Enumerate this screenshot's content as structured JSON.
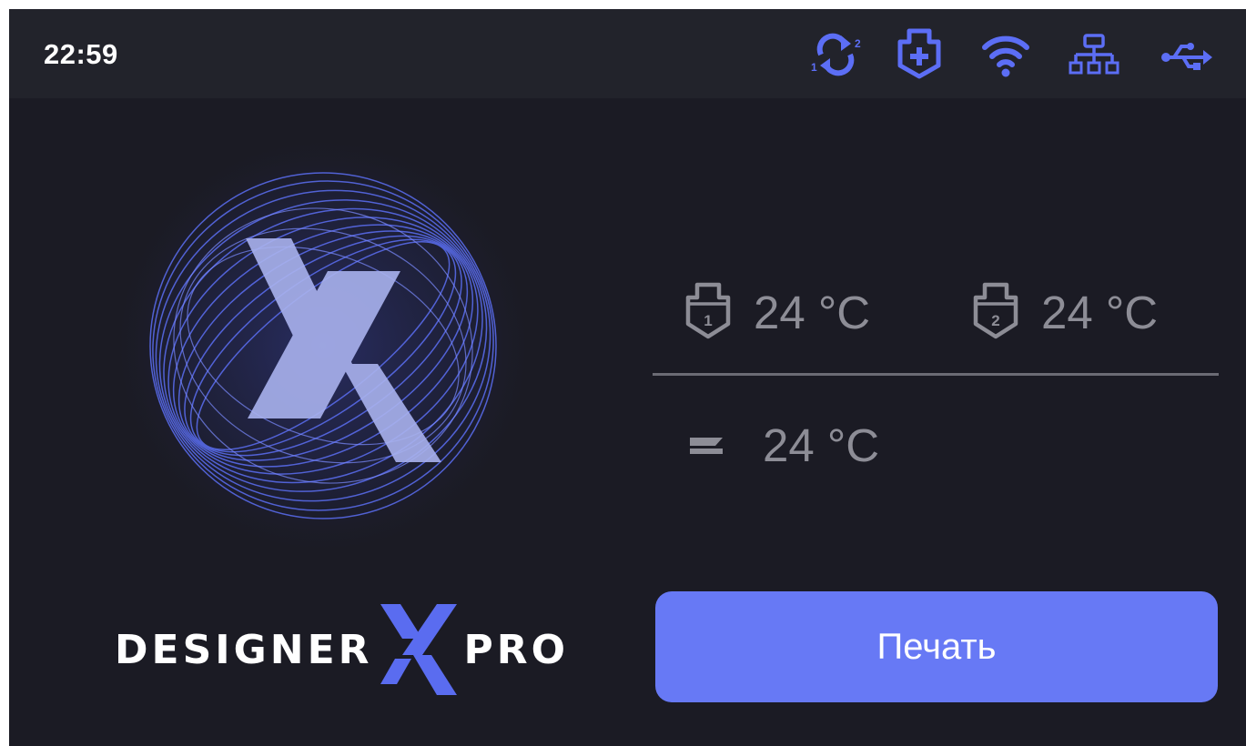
{
  "status_bar": {
    "time": "22:59",
    "icons": [
      "sync-1-2-icon",
      "cloud-plus-shield-icon",
      "wifi-icon",
      "network-icon",
      "usb-icon"
    ],
    "icon_color": "#5c6ef5"
  },
  "logo": {
    "brand_left": "DESIGNER",
    "brand_right": "PRO",
    "accent": "#5a6cf0"
  },
  "temperatures": {
    "extruder1": {
      "value": "24 °C",
      "badge": "1"
    },
    "extruder2": {
      "value": "24 °C",
      "badge": "2"
    },
    "bed": {
      "value": "24 °C"
    }
  },
  "actions": {
    "print_label": "Печать"
  }
}
